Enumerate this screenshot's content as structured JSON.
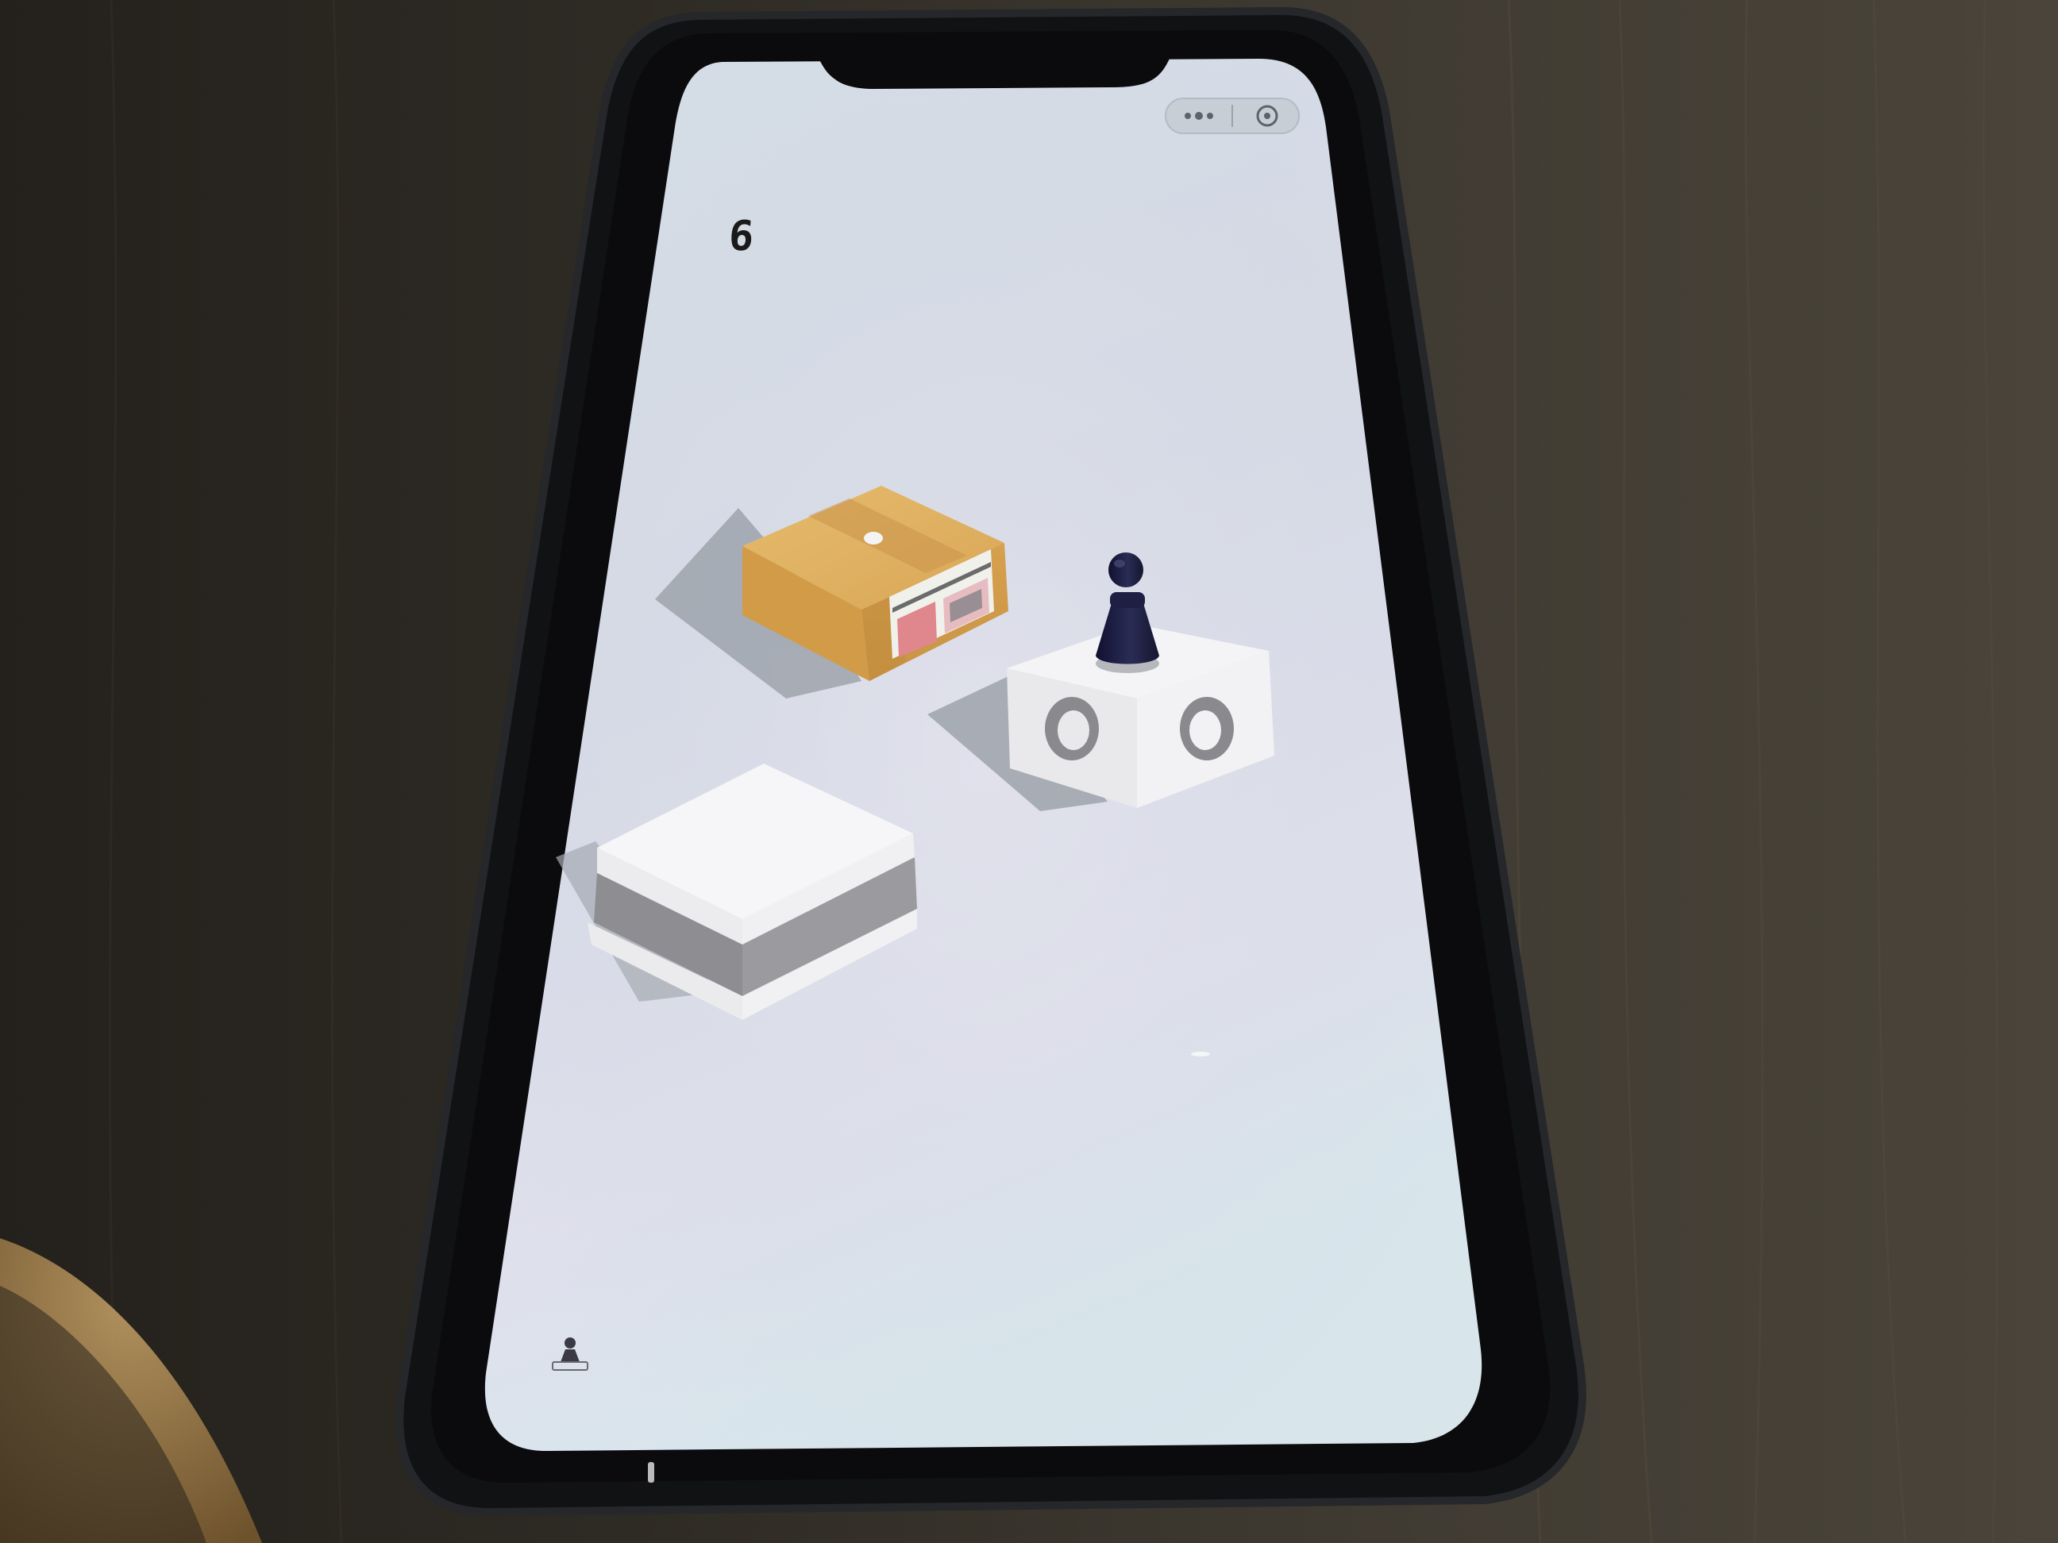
{
  "game": {
    "score": "6",
    "capsule": {
      "menu_icon": "ellipsis-icon",
      "close_icon": "target-circle-icon"
    },
    "player_icon": "chess-pawn-icon",
    "rank_icon": "pawn-rank-icon"
  },
  "colors": {
    "wood_background": "#3a362f",
    "phone_body": "#141416",
    "screen_top": "#d8e0e8",
    "screen_bottom": "#dde2ec",
    "cardboard": "#d9a857",
    "white_block": "#f2f2f4",
    "gray_band": "#8e8e92",
    "pawn": "#1b1c3a"
  }
}
